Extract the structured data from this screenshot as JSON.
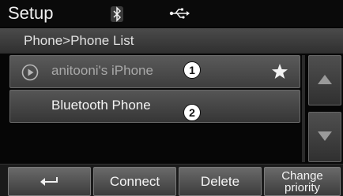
{
  "header": {
    "title": "Setup",
    "status_icons": [
      "bluetooth-icon",
      "usb-icon"
    ]
  },
  "breadcrumb": "Phone>Phone List",
  "phone_list": [
    {
      "name": "anitooni's iPhone",
      "icon": "play-icon",
      "state": "connected",
      "favorite": true,
      "callout": "1"
    },
    {
      "name": "Bluetooth Phone",
      "icon": null,
      "state": "selected",
      "favorite": false,
      "callout": "2"
    }
  ],
  "scroll": {
    "up_icon": "triangle-up-icon",
    "down_icon": "triangle-down-icon"
  },
  "bottom_buttons": {
    "back_icon": "return-arrow-icon",
    "connect": "Connect",
    "delete": "Delete",
    "change_priority_line1": "Change",
    "change_priority_line2": "priority"
  },
  "colors": {
    "screen_bg": "#000000",
    "row_text_dim": "#a8a8a8",
    "row_text": "#f4f4f4"
  }
}
